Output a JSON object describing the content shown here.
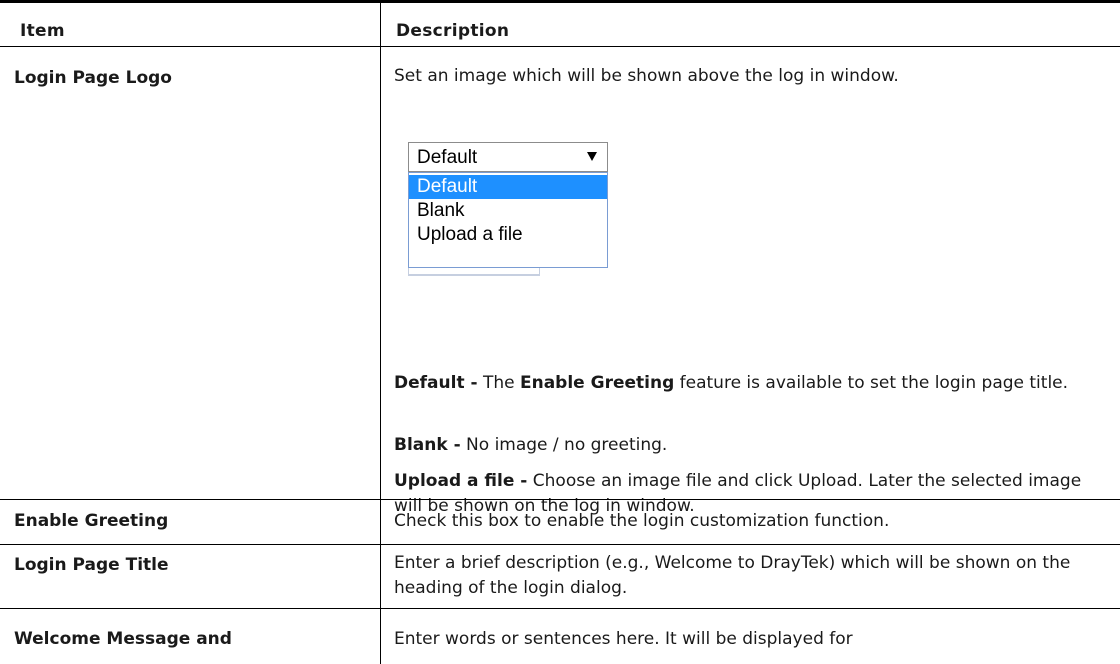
{
  "header": {
    "item": "Item",
    "description": "Description"
  },
  "rows": [
    {
      "item": "Login Page Logo",
      "desc_line1": "Set an image which will be shown above the log in window.",
      "dropdown": {
        "selected": "Default",
        "options": [
          "Default",
          "Blank",
          "Upload a file"
        ],
        "highlighted": "Default"
      },
      "notes": [
        {
          "term": "Default -",
          "parts": [
            " The ",
            "Enable Greeting",
            " feature is available to set the login page title."
          ]
        },
        {
          "term": "Blank -",
          "text": " No image / no greeting."
        },
        {
          "term": "Upload a file -",
          "text": " Choose an image file and click Upload. Later the selected image will be shown on the log in window."
        }
      ]
    },
    {
      "item": "Enable Greeting",
      "desc": "Check this box to enable the login customization function."
    },
    {
      "item": "Login Page Title",
      "desc": "Enter a brief description (e.g., Welcome to DrayTek) which will be shown on the heading of the login dialog."
    },
    {
      "item": "Welcome Message and",
      "desc": "Enter words or sentences here. It will be displayed for"
    }
  ]
}
